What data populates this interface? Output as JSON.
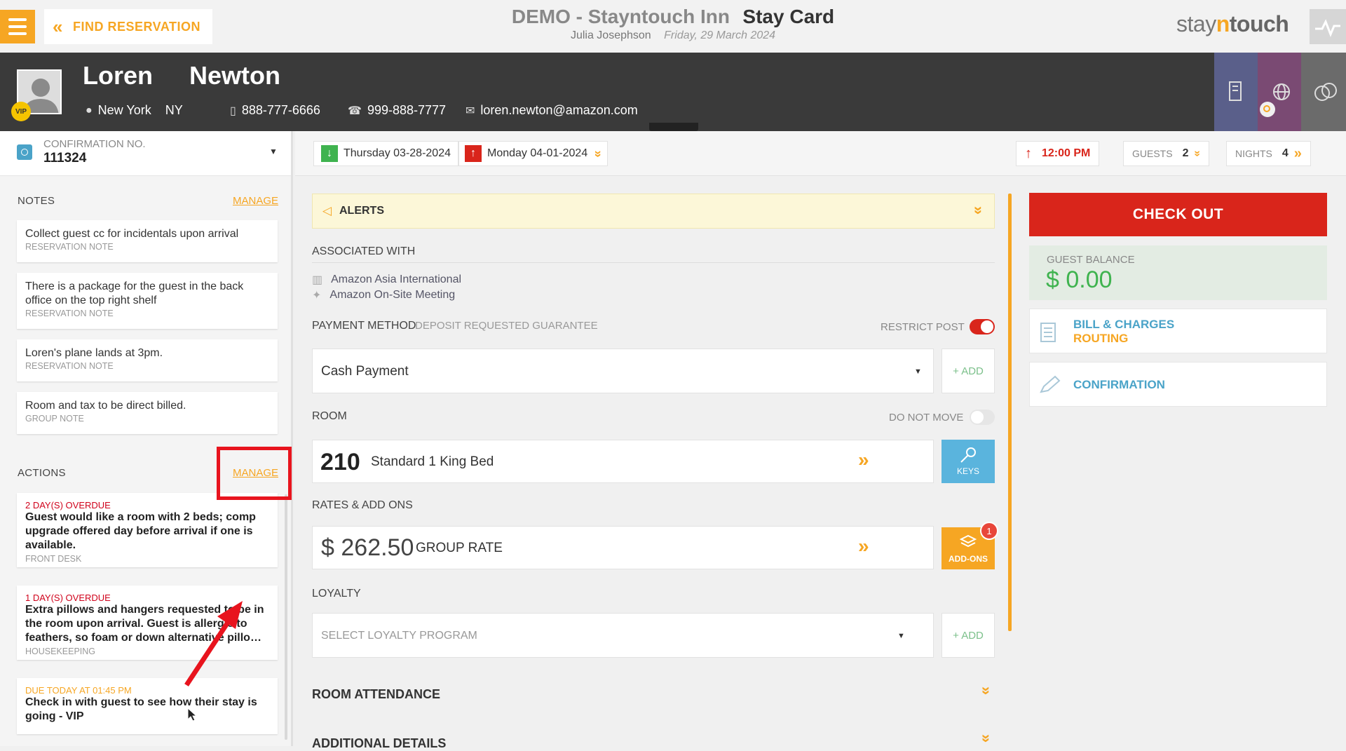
{
  "topbar": {
    "find_reservation": "FIND RESERVATION",
    "hotel_name": "DEMO - Stayntouch Inn",
    "card_title": "Stay Card",
    "user": "Julia Josephson",
    "date": "Friday, 29 March 2024",
    "logo_a": "stay",
    "logo_b": "n",
    "logo_c": "touch"
  },
  "guest": {
    "first_name": "Loren",
    "last_name": "Newton",
    "vip": "VIP",
    "city": "New York",
    "state": "NY",
    "mobile": "888-777-6666",
    "phone": "999-888-7777",
    "email": "loren.newton@amazon.com"
  },
  "confirmation": {
    "label": "CONFIRMATION NO.",
    "number": "111324"
  },
  "notes": {
    "title": "NOTES",
    "manage": "MANAGE",
    "items": [
      {
        "text": "Collect guest cc for incidentals upon arrival",
        "type": "RESERVATION NOTE"
      },
      {
        "text": "There is a package for the guest in the back office on the top right shelf",
        "type": "RESERVATION NOTE"
      },
      {
        "text": "Loren's plane lands at 3pm.",
        "type": "RESERVATION NOTE"
      },
      {
        "text": "Room and tax to be direct billed.",
        "type": "GROUP NOTE"
      }
    ]
  },
  "actions": {
    "title": "ACTIONS",
    "manage": "MANAGE",
    "items": [
      {
        "status": "2 DAY(S) OVERDUE",
        "text": "Guest would like a room with 2 beds; comp upgrade offered day before arrival if one is available.",
        "dept": "FRONT DESK"
      },
      {
        "status": "1 DAY(S) OVERDUE",
        "text": "Extra pillows and hangers requested to be in the room upon arrival. Guest is allergic to feathers, so foam or down alternative pillo…",
        "dept": "HOUSEKEEPING"
      },
      {
        "status": "DUE TODAY AT 01:45 PM",
        "text": "Check in with guest to see how their stay is going - VIP",
        "dept": ""
      }
    ]
  },
  "dates": {
    "arrival": "Thursday 03-28-2024",
    "departure": "Monday 04-01-2024",
    "time": "12:00 PM",
    "guests_label": "GUESTS",
    "guests": "2",
    "nights_label": "NIGHTS",
    "nights": "4"
  },
  "alerts": {
    "label": "ALERTS"
  },
  "associated": {
    "label": "ASSOCIATED WITH",
    "company": "Amazon Asia International",
    "group": "Amazon On-Site Meeting"
  },
  "payment": {
    "label": "PAYMENT METHOD",
    "sub": "DEPOSIT REQUESTED GUARANTEE",
    "restrict_post": "RESTRICT POST",
    "restrict_on": true,
    "method": "Cash Payment",
    "add": "+ ADD"
  },
  "room": {
    "label": "ROOM",
    "do_not_move": "DO NOT MOVE",
    "number": "210",
    "type": "Standard 1 King Bed",
    "keys": "KEYS"
  },
  "rates": {
    "label": "RATES & ADD ONS",
    "currency": "$",
    "amount": "262.50",
    "rate_name": "GROUP RATE",
    "addons": "ADD-ONS",
    "addons_count": "1"
  },
  "loyalty": {
    "label": "LOYALTY",
    "placeholder": "SELECT LOYALTY PROGRAM",
    "add": "+ ADD"
  },
  "sections": {
    "room_attendance": "ROOM ATTENDANCE",
    "additional_details": "ADDITIONAL DETAILS"
  },
  "right": {
    "checkout": "CHECK OUT",
    "balance_label": "GUEST BALANCE",
    "balance_currency": "$",
    "balance_value": "0.00",
    "bill_line1": "BILL & CHARGES",
    "bill_line2": "ROUTING",
    "confirmation": "CONFIRMATION"
  },
  "colors": {
    "accent": "#f6a623",
    "checkout": "#d9251b",
    "header": "#3a3a3a",
    "link_blue": "#4aa3c8",
    "overdue": "#d0021b",
    "annotation": "#e8141e"
  }
}
